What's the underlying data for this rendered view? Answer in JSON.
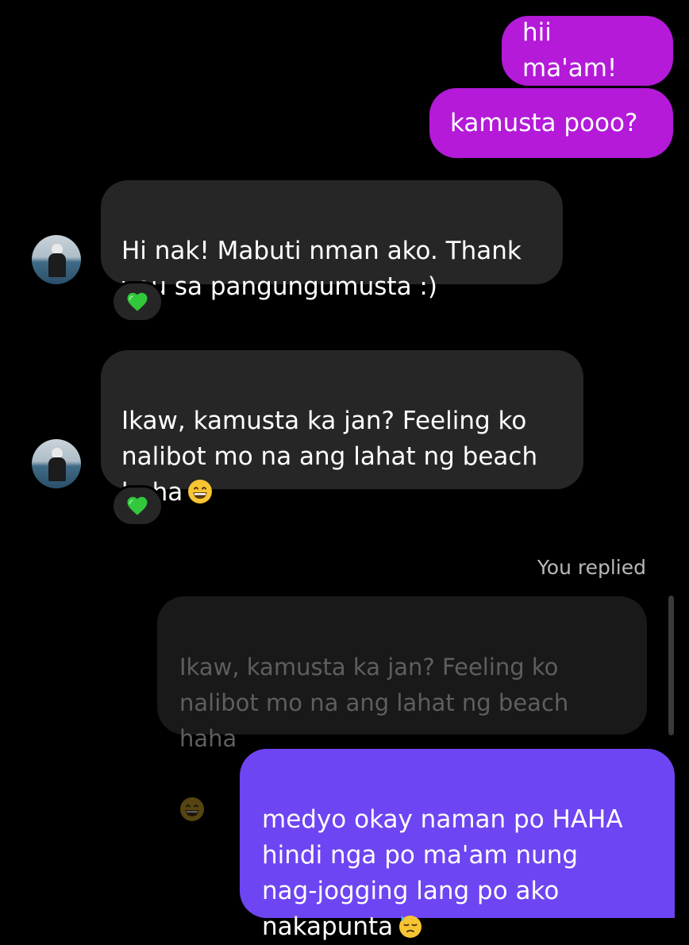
{
  "messages": {
    "sent_1": "hii ma'am!",
    "sent_2": "kamusta pooo?",
    "received_1": "Hi nak! Mabuti nman ako. Thank\nyou sa pangungumusta :)",
    "received_2": "Ikaw, kamusta ka jan? Feeling ko\nnalibot mo na ang lahat ng beach\nhaha",
    "reply_label": "You replied",
    "quoted": "Ikaw, kamusta ka jan? Feeling ko\nnalibot mo na ang lahat ng beach haha",
    "sent_reply": "medyo okay naman po HAHA\nhindi nga po ma'am nung\nnag-jogging lang po ako\nnakapunta"
  },
  "reactions": {
    "received_1": "green-heart",
    "received_2": "green-heart"
  },
  "emojis": {
    "received_2": "grinning-face",
    "quoted": "grinning-face",
    "sent_reply": "downcast-face-with-sweat"
  },
  "colors": {
    "background": "#000000",
    "sent_magenta": "#b41ad8",
    "sent_purple": "#6e45f2",
    "received_bubble": "#262626",
    "quoted_bubble": "#191919",
    "quoted_text": "#5e5e5e",
    "heart": "#32c83c"
  }
}
